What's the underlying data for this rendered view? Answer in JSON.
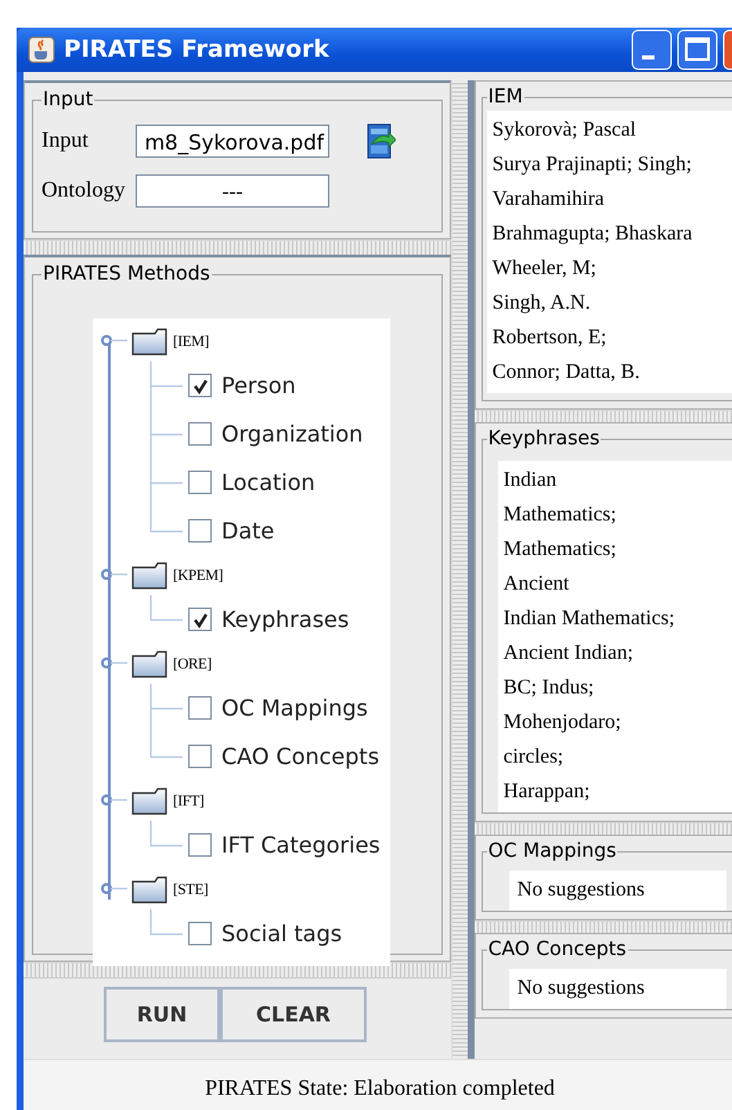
{
  "window": {
    "title": "PIRATES Framework"
  },
  "input_panel": {
    "title": "Input",
    "fields": [
      {
        "label": "Input",
        "value": "m8_Sykorova.pdf"
      },
      {
        "label": "Ontology",
        "value": "---"
      }
    ]
  },
  "methods_panel": {
    "title": "PIRATES Methods",
    "tree": [
      {
        "label": "[IEM]",
        "children": [
          {
            "label": "Person",
            "checked": true
          },
          {
            "label": "Organization",
            "checked": false
          },
          {
            "label": "Location",
            "checked": false
          },
          {
            "label": "Date",
            "checked": false
          }
        ]
      },
      {
        "label": "[KPEM]",
        "children": [
          {
            "label": "Keyphrases",
            "checked": true
          }
        ]
      },
      {
        "label": "[ORE]",
        "children": [
          {
            "label": "OC Mappings",
            "checked": false
          },
          {
            "label": "CAO Concepts",
            "checked": false
          }
        ]
      },
      {
        "label": "[IFT]",
        "children": [
          {
            "label": "IFT Categories",
            "checked": false
          }
        ]
      },
      {
        "label": "[STE]",
        "children": [
          {
            "label": "Social tags",
            "checked": false
          }
        ]
      }
    ]
  },
  "buttons": [
    "RUN",
    "CLEAR"
  ],
  "result_panels": [
    {
      "title": "IEM",
      "lines": [
        "Sykorovà; Pascal",
        "Surya Prajinapti; Singh;",
        "Varahamihira",
        "Brahmagupta; Bhaskara",
        "Wheeler, M;",
        "Singh, A.N.",
        "Robertson, E;",
        "Connor; Datta, B."
      ]
    },
    {
      "title": "Keyphrases",
      "lines": [
        "Indian",
        "Mathematics;",
        "Mathematics;",
        "Ancient",
        "Indian Mathematics;",
        "Ancient Indian;",
        "BC;  Indus;",
        "Mohenjodaro;",
        "circles;",
        "Harappan;"
      ]
    },
    {
      "title": "OC Mappings",
      "lines": [
        "No suggestions"
      ]
    },
    {
      "title": "CAO Concepts",
      "lines": [
        "No suggestions"
      ]
    }
  ],
  "status_bar": "PIRATES State:  Elaboration completed"
}
